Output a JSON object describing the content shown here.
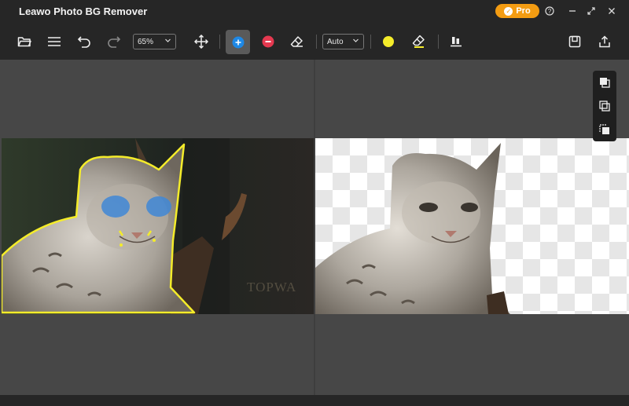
{
  "app": {
    "title": "Leawo Photo BG Remover",
    "pro_label": "Pro"
  },
  "window": {
    "help_icon": "help-icon",
    "maximize_icon": "expand-icon",
    "close_icon": "close-icon"
  },
  "toolbar": {
    "zoom_value": "65%",
    "brush_mode_value": "Auto",
    "icons": [
      "folder-open-icon",
      "menu-icon",
      "undo-icon",
      "redo-icon",
      "move-icon",
      "add-brush-icon",
      "remove-brush-icon",
      "eraser-icon",
      "color-dot-icon",
      "eraser-fill-icon",
      "align-icon",
      "save-icon",
      "export-icon"
    ]
  },
  "canvas": {
    "watermark_text": "TOPWA"
  },
  "side_tools": [
    "copy-icon",
    "duplicate-icon",
    "layers-icon"
  ],
  "colors": {
    "accent_blue": "#1e88e5",
    "remove_red": "#e53950",
    "selection_yellow": "#f4ec2a",
    "pro_orange": "#f39c12"
  }
}
